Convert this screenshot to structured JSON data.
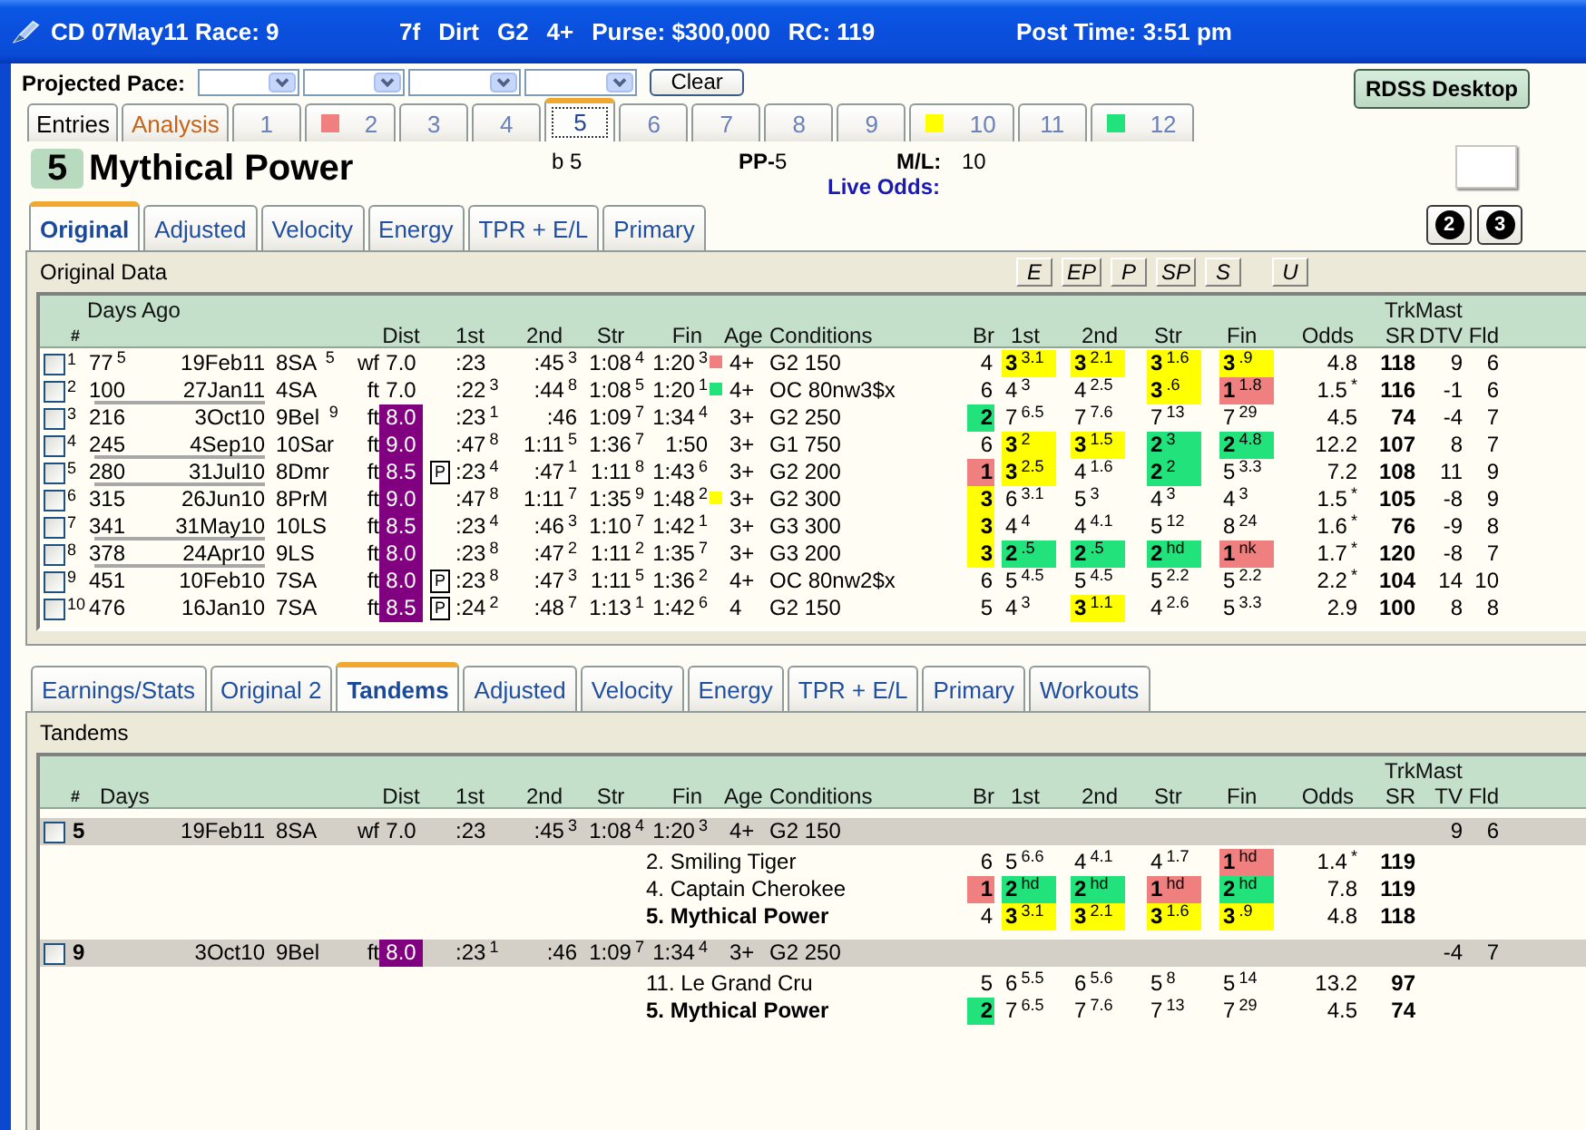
{
  "title_bar": {
    "race": "CD 07May11 Race: 9",
    "conditions": [
      "7f",
      "Dirt",
      "G2",
      "4+",
      "Purse: $300,000",
      "RC: 119"
    ],
    "post_time": "Post Time: 3:51 pm"
  },
  "pace": {
    "label": "Projected Pace:",
    "clear_button": "Clear"
  },
  "desktop_button": "RDSS Desktop",
  "horse_tabs": [
    {
      "label": "Entries",
      "kind": "entries",
      "selected": false
    },
    {
      "label": "Analysis",
      "kind": "analysis",
      "selected": false
    },
    {
      "label": "1",
      "kind": "horse",
      "selected": false
    },
    {
      "label": "2",
      "kind": "horse",
      "selected": false,
      "color": "#f08080"
    },
    {
      "label": "3",
      "kind": "horse",
      "selected": false
    },
    {
      "label": "4",
      "kind": "horse",
      "selected": false
    },
    {
      "label": "5",
      "kind": "horse",
      "selected": true
    },
    {
      "label": "6",
      "kind": "horse",
      "selected": false
    },
    {
      "label": "7",
      "kind": "horse",
      "selected": false
    },
    {
      "label": "8",
      "kind": "horse",
      "selected": false
    },
    {
      "label": "9",
      "kind": "horse",
      "selected": false
    },
    {
      "label": "10",
      "kind": "horse",
      "selected": false,
      "color": "#ffff00"
    },
    {
      "label": "11",
      "kind": "horse",
      "selected": false
    },
    {
      "label": "12",
      "kind": "horse",
      "selected": false,
      "color": "#22e27c"
    }
  ],
  "horse": {
    "number": "5",
    "name": "Mythical Power",
    "description": "b 5",
    "post_position": "**PP-**5",
    "ml_label": "M/L:",
    "ml_value": "10",
    "live_odds_label": "Live Odds:"
  },
  "circle_buttons": [
    "2",
    "3"
  ],
  "original_panel": {
    "tabs": [
      {
        "label": "Original",
        "selected": true
      },
      {
        "label": "Adjusted",
        "selected": false
      },
      {
        "label": "Velocity",
        "selected": false
      },
      {
        "label": "Energy",
        "selected": false
      },
      {
        "label": "TPR + E/L",
        "selected": false
      },
      {
        "label": "Primary",
        "selected": false
      }
    ],
    "title": "Original Data",
    "style_buttons": [
      "E",
      "EP",
      "P",
      "SP",
      "S",
      "U"
    ],
    "column_groups": [
      "Days Ago",
      "TrkMast"
    ],
    "columns": [
      "#",
      "Dist",
      "1st",
      "2nd",
      "Str",
      "Fin",
      "Age",
      "Conditions",
      "Br",
      "1st",
      "2nd",
      "Str",
      "Fin",
      "Odds",
      "SR",
      "DTV",
      "Fld"
    ],
    "rows": [
      {
        "checked": false,
        "num": "1",
        "days": "77$^{5}$",
        "date": "19Feb11",
        "track": "8SA $^{5}$",
        "surface": "wf",
        "dist": "7.0",
        "dist_marked": false,
        "first": ":23",
        "second": ":45$^{3}$",
        "stretch": "1:08$^{4}$",
        "finish": "1:20$^{3}$",
        "fin_marker": {
          "color": "#f08080"
        },
        "age": "4+",
        "conditions": "G2 150",
        "post": {
          "text": "4"
        },
        "calls": [
          {
            "text": "**3**$^{3.1}$",
            "color": "#ffff00"
          },
          {
            "text": "**3**$^{2.1}$",
            "color": "#ffff00"
          },
          {
            "text": "**3**$^{1.6}$",
            "color": "#ffff00"
          },
          {
            "text": "**3**$^{.9}$",
            "color": "#ffff00"
          }
        ],
        "odds": "4.8",
        "sr": "118",
        "dtv": "9",
        "fld": "6",
        "underlined": false
      },
      {
        "checked": false,
        "num": "2",
        "days": "100",
        "date": "27Jan11",
        "track": "4SA",
        "surface": "ft",
        "dist": "7.0",
        "dist_marked": false,
        "first": ":22$^{3}$",
        "second": ":44$^{8}$",
        "stretch": "1:08$^{5}$",
        "finish": "1:20$^{1}$",
        "fin_marker": {
          "color": "#22e27c"
        },
        "age": "4+",
        "conditions": "OC 80nw3$x",
        "post": {
          "text": "6"
        },
        "calls": [
          {
            "text": "4$^{3}$"
          },
          {
            "text": "4$^{2.5}$"
          },
          {
            "text": "**3**$^{.6}$",
            "color": "#ffff00"
          },
          {
            "text": "**1**$^{1.8}$",
            "color": "#f08080"
          }
        ],
        "odds": "1.5",
        "odds_mark": "*",
        "sr": "116",
        "dtv": "-1",
        "fld": "6",
        "underlined": true
      },
      {
        "checked": false,
        "num": "3",
        "days": "216",
        "date": "3Oct10",
        "track": "9Bel $^{9}$",
        "surface": "ft",
        "dist": "8.0",
        "dist_marked": true,
        "first": ":23$^{1}$",
        "second": ":46",
        "stretch": "1:09$^{7}$",
        "finish": "1:34$^{4}$",
        "age": "3+",
        "conditions": "G2 250",
        "post": {
          "text": "2",
          "color": "#22e27c"
        },
        "calls": [
          {
            "text": "7$^{6.5}$"
          },
          {
            "text": "7$^{7.6}$"
          },
          {
            "text": "7$^{13}$"
          },
          {
            "text": "7$^{29}$"
          }
        ],
        "odds": "4.5",
        "sr": "74",
        "dtv": "-4",
        "fld": "7",
        "underlined": false
      },
      {
        "checked": false,
        "num": "4",
        "days": "245",
        "date": "4Sep10",
        "track": "10Sar",
        "surface": "ft",
        "dist": "9.0",
        "dist_marked": true,
        "first": ":47$^{8}$",
        "second": "1:11$^{5}$",
        "stretch": "1:36$^{7}$",
        "finish": "1:50",
        "age": "3+",
        "conditions": "G1 750",
        "post": {
          "text": "6"
        },
        "calls": [
          {
            "text": "**3**$^{2}$",
            "color": "#ffff00"
          },
          {
            "text": "**3**$^{1.5}$",
            "color": "#ffff00"
          },
          {
            "text": "**2**$^{3}$",
            "color": "#22e27c"
          },
          {
            "text": "**2**$^{4.8}$",
            "color": "#22e27c"
          }
        ],
        "odds": "12.2",
        "sr": "107",
        "dtv": "8",
        "fld": "7",
        "underlined": true
      },
      {
        "checked": false,
        "num": "5",
        "days": "280",
        "date": "31Jul10",
        "track": "8Dmr",
        "surface": "ft",
        "dist": "8.5",
        "dist_marked": true,
        "flag": "P",
        "first": ":23$^{4}$",
        "second": ":47$^{1}$",
        "stretch": "1:11$^{8}$",
        "finish": "1:43$^{6}$",
        "age": "3+",
        "conditions": "G2 200",
        "post": {
          "text": "1",
          "color": "#f08080"
        },
        "calls": [
          {
            "text": "**3**$^{2.5}$",
            "color": "#ffff00"
          },
          {
            "text": "4$^{1.6}$"
          },
          {
            "text": "**2**$^{2}$",
            "color": "#22e27c"
          },
          {
            "text": "5$^{3.3}$"
          }
        ],
        "odds": "7.2",
        "sr": "108",
        "dtv": "11",
        "fld": "9",
        "underlined": true
      },
      {
        "checked": false,
        "num": "6",
        "days": "315",
        "date": "26Jun10",
        "track": "8PrM",
        "surface": "ft",
        "dist": "9.0",
        "dist_marked": true,
        "first": ":47$^{8}$",
        "second": "1:11$^{7}$",
        "stretch": "1:35$^{9}$",
        "finish": "1:48$^{2}$",
        "fin_marker": {
          "color": "#ffff00"
        },
        "age": "3+",
        "conditions": "G2 300",
        "post": {
          "text": "3",
          "color": "#ffff00"
        },
        "calls": [
          {
            "text": "6$^{3.1}$"
          },
          {
            "text": "5$^{3}$"
          },
          {
            "text": "4$^{3}$"
          },
          {
            "text": "4$^{3}$"
          }
        ],
        "odds": "1.5",
        "odds_mark": "*",
        "sr": "105",
        "dtv": "-8",
        "fld": "9",
        "underlined": false
      },
      {
        "checked": false,
        "num": "7",
        "days": "341",
        "date": "31May10",
        "track": "10LS",
        "surface": "ft",
        "dist": "8.5",
        "dist_marked": true,
        "first": ":23$^{4}$",
        "second": ":46$^{3}$",
        "stretch": "1:10$^{7}$",
        "finish": "1:42$^{1}$",
        "age": "3+",
        "conditions": "G3 300",
        "post": {
          "text": "3",
          "color": "#ffff00"
        },
        "calls": [
          {
            "text": "4$^{4}$"
          },
          {
            "text": "4$^{4.1}$"
          },
          {
            "text": "5$^{12}$"
          },
          {
            "text": "8$^{24}$"
          }
        ],
        "odds": "1.6",
        "odds_mark": "*",
        "sr": "76",
        "dtv": "-9",
        "fld": "8",
        "underlined": true
      },
      {
        "checked": false,
        "num": "8",
        "days": "378",
        "date": "24Apr10",
        "track": "9LS",
        "surface": "ft",
        "dist": "8.0",
        "dist_marked": true,
        "first": ":23$^{8}$",
        "second": ":47$^{2}$",
        "stretch": "1:11$^{2}$",
        "finish": "1:35$^{7}$",
        "age": "3+",
        "conditions": "G3 200",
        "post": {
          "text": "3",
          "color": "#ffff00"
        },
        "calls": [
          {
            "text": "**2**$^{.5}$",
            "color": "#22e27c"
          },
          {
            "text": "**2**$^{.5}$",
            "color": "#22e27c"
          },
          {
            "text": "**2**$^{hd}$",
            "color": "#22e27c"
          },
          {
            "text": "**1**$^{nk}$",
            "color": "#f08080"
          }
        ],
        "odds": "1.7",
        "odds_mark": "*",
        "sr": "120",
        "dtv": "-8",
        "fld": "7",
        "underlined": true
      },
      {
        "checked": false,
        "num": "9",
        "days": "451",
        "date": "10Feb10",
        "track": "7SA",
        "surface": "ft",
        "dist": "8.0",
        "dist_marked": true,
        "flag": "P",
        "first": ":23$^{8}$",
        "second": ":47$^{3}$",
        "stretch": "1:11$^{5}$",
        "finish": "1:36$^{2}$",
        "age": "4+",
        "conditions": "OC 80nw2$x",
        "post": {
          "text": "6"
        },
        "calls": [
          {
            "text": "5$^{4.5}$"
          },
          {
            "text": "5$^{4.5}$"
          },
          {
            "text": "5$^{2.2}$"
          },
          {
            "text": "5$^{2.2}$"
          }
        ],
        "odds": "2.2",
        "odds_mark": "*",
        "sr": "104",
        "dtv": "14",
        "fld": "10",
        "underlined": false
      },
      {
        "checked": false,
        "num": "10",
        "days": "476",
        "date": "16Jan10",
        "track": "7SA",
        "surface": "ft",
        "dist": "8.5",
        "dist_marked": true,
        "flag": "P",
        "first": ":24$^{2}$",
        "second": ":48$^{7}$",
        "stretch": "1:13$^{1}$",
        "finish": "1:42$^{6}$",
        "age": "4",
        "conditions": "G2 150",
        "post": {
          "text": "5"
        },
        "calls": [
          {
            "text": "4$^{3}$"
          },
          {
            "text": "**3**$^{1.1}$",
            "color": "#ffff00"
          },
          {
            "text": "4$^{2.6}$"
          },
          {
            "text": "5$^{3.3}$"
          }
        ],
        "odds": "2.9",
        "sr": "100",
        "dtv": "8",
        "fld": "8",
        "underlined": false
      }
    ]
  },
  "tandems_panel": {
    "tabs": [
      {
        "label": "Earnings/Stats",
        "selected": false
      },
      {
        "label": "Original 2",
        "selected": false
      },
      {
        "label": "Tandems",
        "selected": true
      },
      {
        "label": "Adjusted",
        "selected": false
      },
      {
        "label": "Velocity",
        "selected": false
      },
      {
        "label": "Energy",
        "selected": false
      },
      {
        "label": "TPR + E/L",
        "selected": false
      },
      {
        "label": "Primary",
        "selected": false
      },
      {
        "label": "Workouts",
        "selected": false
      }
    ],
    "title": "Tandems",
    "column_groups": [
      "TrkMast"
    ],
    "columns": [
      "#",
      "Days",
      "Dist",
      "1st",
      "2nd",
      "Str",
      "Fin",
      "Age",
      "Conditions",
      "Br",
      "1st",
      "2nd",
      "Str",
      "Fin",
      "Odds",
      "SR",
      "TV",
      "Fld"
    ],
    "groups": [
      {
        "checked": false,
        "num": "5",
        "date": "19Feb11",
        "track": "8SA",
        "surface": "wf",
        "dist": "7.0",
        "dist_marked": false,
        "first": ":23",
        "second": ":45$^{3}$",
        "stretch": "1:08$^{4}$",
        "finish": "1:20$^{3}$",
        "age": "4+",
        "conditions": "G2 150",
        "tv": "9",
        "fld": "6",
        "entries": [
          {
            "name": "2. Smiling Tiger",
            "subject": false,
            "post": {
              "text": "6"
            },
            "calls": [
              {
                "text": "5$^{6.6}$"
              },
              {
                "text": "4$^{4.1}$"
              },
              {
                "text": "4$^{1.7}$"
              },
              {
                "text": "**1**$^{hd}$",
                "color": "#f08080"
              }
            ],
            "odds": "1.4",
            "odds_mark": "*",
            "sr": "119"
          },
          {
            "name": "4. Captain Cherokee",
            "subject": false,
            "post": {
              "text": "1",
              "color": "#f08080"
            },
            "calls": [
              {
                "text": "**2**$^{hd}$",
                "color": "#22e27c"
              },
              {
                "text": "**2**$^{hd}$",
                "color": "#22e27c"
              },
              {
                "text": "**1**$^{hd}$",
                "color": "#f08080"
              },
              {
                "text": "**2**$^{hd}$",
                "color": "#22e27c"
              }
            ],
            "odds": "7.8",
            "sr": "119"
          },
          {
            "name": "5. Mythical Power",
            "subject": true,
            "post": {
              "text": "4"
            },
            "calls": [
              {
                "text": "**3**$^{3.1}$",
                "color": "#ffff00"
              },
              {
                "text": "**3**$^{2.1}$",
                "color": "#ffff00"
              },
              {
                "text": "**3**$^{1.6}$",
                "color": "#ffff00"
              },
              {
                "text": "**3**$^{.9}$",
                "color": "#ffff00"
              }
            ],
            "odds": "4.8",
            "sr": "118"
          }
        ]
      },
      {
        "checked": false,
        "num": "9",
        "date": "3Oct10",
        "track": "9Bel",
        "surface": "ft",
        "dist": "8.0",
        "dist_marked": true,
        "first": ":23$^{1}$",
        "second": ":46",
        "stretch": "1:09$^{7}$",
        "finish": "1:34$^{4}$",
        "age": "3+",
        "conditions": "G2 250",
        "tv": "-4",
        "fld": "7",
        "entries": [
          {
            "name": "11. Le Grand Cru",
            "subject": false,
            "post": {
              "text": "5"
            },
            "calls": [
              {
                "text": "6$^{5.5}$"
              },
              {
                "text": "6$^{5.6}$"
              },
              {
                "text": "5$^{8}$"
              },
              {
                "text": "5$^{14}$"
              }
            ],
            "odds": "13.2",
            "sr": "97"
          },
          {
            "name": "5. Mythical Power",
            "subject": true,
            "post": {
              "text": "2",
              "color": "#22e27c"
            },
            "calls": [
              {
                "text": "7$^{6.5}$"
              },
              {
                "text": "7$^{7.6}$"
              },
              {
                "text": "7$^{13}$"
              },
              {
                "text": "7$^{29}$"
              }
            ],
            "odds": "4.5",
            "sr": "74"
          }
        ]
      }
    ]
  }
}
